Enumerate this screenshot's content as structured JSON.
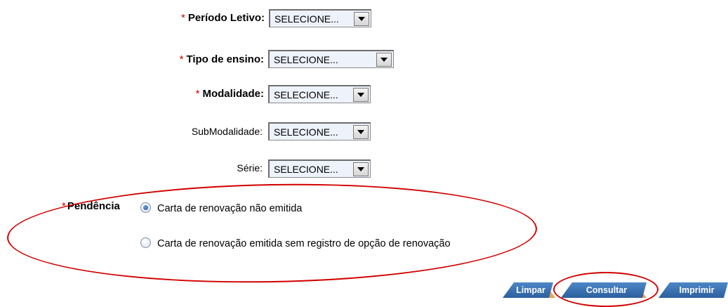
{
  "form": {
    "periodo": {
      "required": "*",
      "label": "Período Letivo:",
      "value": "SELECIONE..."
    },
    "tipo": {
      "required": "*",
      "label": "Tipo de ensino:",
      "value": "SELECIONE..."
    },
    "modalidade": {
      "required": "*",
      "label": "Modalidade:",
      "value": "SELECIONE..."
    },
    "submodalidade": {
      "label": "SubModalidade:",
      "value": "SELECIONE..."
    },
    "serie": {
      "label": "Série:",
      "value": "SELECIONE..."
    },
    "pendencia": {
      "required": "*",
      "label": "Pendência",
      "options": [
        {
          "label": "Carta de renovação não emitida",
          "selected": true
        },
        {
          "label": "Carta de renovação emitida sem registro de opção de renovação",
          "selected": false
        }
      ]
    }
  },
  "actions": {
    "limpar": "Limpar",
    "consultar": "Consultar",
    "imprimir": "Imprimir"
  },
  "colors": {
    "required": "#d40000",
    "highlight": "#d10000",
    "button": "#3a6fb0"
  }
}
